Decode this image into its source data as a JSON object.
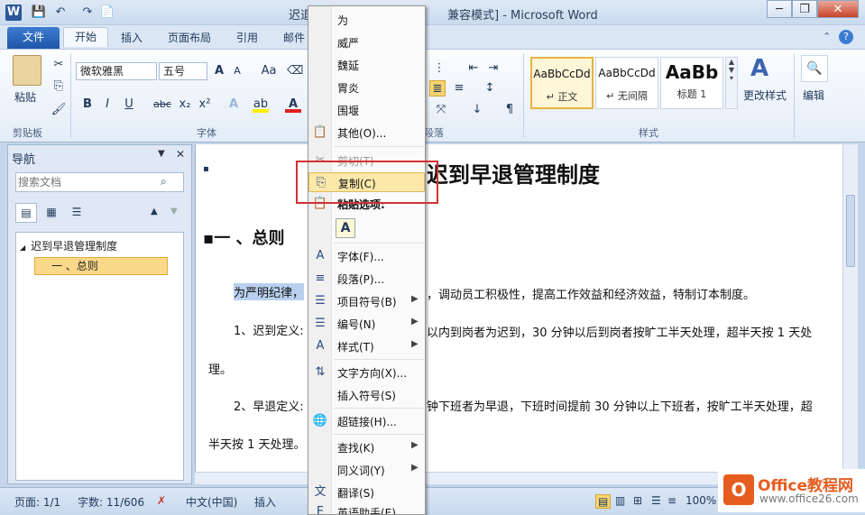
{
  "window": {
    "title_left": "迟退",
    "title_right": "兼容模式] - Microsoft Word",
    "min": "─",
    "restore": "❐",
    "close": "✕"
  },
  "qat": {
    "word_icon": "W",
    "save_icon": "💾",
    "undo_icon": "↶",
    "redo_icon": "↷",
    "new_icon": "📄"
  },
  "tabs": [
    "文件",
    "开始",
    "插入",
    "页面布局",
    "引用",
    "邮件"
  ],
  "ribbon": {
    "clipboard": {
      "paste": "粘贴",
      "label": "剪贴板"
    },
    "font": {
      "name": "微软雅黑",
      "size": "五号",
      "label": "字体"
    },
    "paragraph": {
      "label": "段落"
    },
    "styles": {
      "items": [
        {
          "sample": "AaBbCcDd",
          "name": "↵ 正文"
        },
        {
          "sample": "AaBbCcDd",
          "name": "↵ 无间隔"
        },
        {
          "sample": "AaBb",
          "name": "标题 1"
        }
      ],
      "change": "更改样式",
      "label": "样式"
    },
    "edit": {
      "label": "编辑"
    }
  },
  "nav": {
    "title": "导航",
    "search_placeholder": "搜索文档",
    "tree": [
      {
        "label": "迟到早退管理制度"
      },
      {
        "label": "一 、总则"
      }
    ]
  },
  "doc": {
    "title": "迟到早退管理制度",
    "heading": "一 、总则",
    "sel_text": "为严明纪律，",
    "p1_rest": "，调动员工积极性，提高工作效益和经济效益，特制订本制度。",
    "p2_start": "1、迟到定义:",
    "p2_rest": "以内到岗者为迟到，30 分钟以后到岗者按旷工半天处理，超半天按 1 天处",
    "p2_end": "理。",
    "p3_start": "2、早退定义:",
    "p3_rest": "钟下班者为早退，下班时间提前 30 分钟以上下班者，按旷工半天处理，超",
    "p3_end": "半天按 1 天处理。"
  },
  "menu": {
    "items": [
      {
        "label": "为",
        "icon": ""
      },
      {
        "label": "威严",
        "icon": ""
      },
      {
        "label": "魏延",
        "icon": ""
      },
      {
        "label": "胃炎",
        "icon": ""
      },
      {
        "label": "围堰",
        "icon": ""
      },
      {
        "label": "其他(O)...",
        "icon": "📋"
      },
      {
        "label": "剪切(T)",
        "icon": "✂"
      },
      {
        "label": "复制(C)",
        "icon": "⎘"
      },
      {
        "label": "粘贴选项:",
        "icon": "📋"
      },
      {
        "label": "字体(F)...",
        "icon": "A"
      },
      {
        "label": "段落(P)...",
        "icon": "≡"
      },
      {
        "label": "项目符号(B)",
        "icon": "☰"
      },
      {
        "label": "编号(N)",
        "icon": "☰"
      },
      {
        "label": "样式(T)",
        "icon": "A"
      },
      {
        "label": "文字方向(X)...",
        "icon": "⇅"
      },
      {
        "label": "插入符号(S)",
        "icon": ""
      },
      {
        "label": "超链接(H)...",
        "icon": "🌐"
      },
      {
        "label": "查找(K)",
        "icon": ""
      },
      {
        "label": "同义词(Y)",
        "icon": ""
      },
      {
        "label": "翻译(S)",
        "icon": "文"
      },
      {
        "label": "英语助手(E)",
        "icon": "E"
      }
    ],
    "paste_btn": "A"
  },
  "status": {
    "page": "页面: 1/1",
    "words": "字数: 11/606",
    "lang": "中文(中国)",
    "mode": "插入",
    "zoom": "100%"
  },
  "logo": {
    "text": "Office教程网",
    "url": "www.office26.com"
  },
  "colors": {
    "accent": "#2b579a",
    "menu_highlight": "#fce8a8",
    "frame": "#d23232"
  }
}
